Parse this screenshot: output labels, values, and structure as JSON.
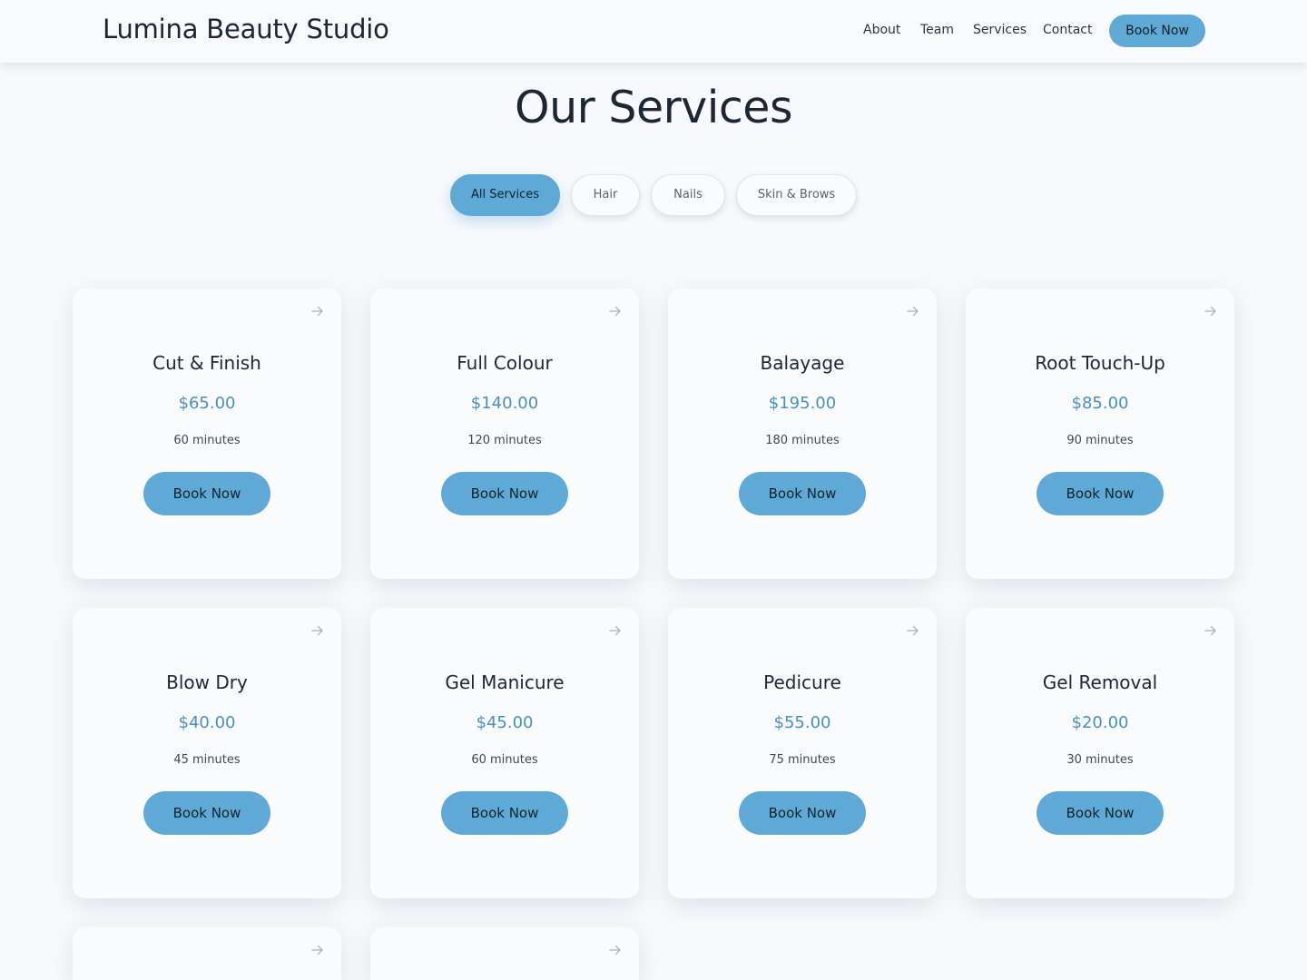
{
  "header": {
    "brand": "Lumina Beauty Studio",
    "nav": [
      "About",
      "Team",
      "Services",
      "Contact"
    ],
    "cta": "Book Now"
  },
  "page": {
    "title": "Our Services"
  },
  "filters": {
    "items": [
      "All Services",
      "Hair",
      "Nails",
      "Skin & Brows"
    ],
    "active": "All Services"
  },
  "services": [
    {
      "name": "Cut & Finish",
      "price": "$65.00",
      "duration": "60 minutes",
      "cta": "Book Now"
    },
    {
      "name": "Full Colour",
      "price": "$140.00",
      "duration": "120 minutes",
      "cta": "Book Now"
    },
    {
      "name": "Balayage",
      "price": "$195.00",
      "duration": "180 minutes",
      "cta": "Book Now"
    },
    {
      "name": "Root Touch-Up",
      "price": "$85.00",
      "duration": "90 minutes",
      "cta": "Book Now"
    },
    {
      "name": "Blow Dry",
      "price": "$40.00",
      "duration": "45 minutes",
      "cta": "Book Now"
    },
    {
      "name": "Gel Manicure",
      "price": "$45.00",
      "duration": "60 minutes",
      "cta": "Book Now"
    },
    {
      "name": "Pedicure",
      "price": "$55.00",
      "duration": "75 minutes",
      "cta": "Book Now"
    },
    {
      "name": "Gel Removal",
      "price": "$20.00",
      "duration": "30 minutes",
      "cta": "Book Now"
    }
  ],
  "icons": {
    "card_corner": "arrow-right-icon"
  },
  "colors": {
    "accent": "#5ea9d6",
    "price": "#4a8fbb",
    "background": "#f7f9fc"
  }
}
